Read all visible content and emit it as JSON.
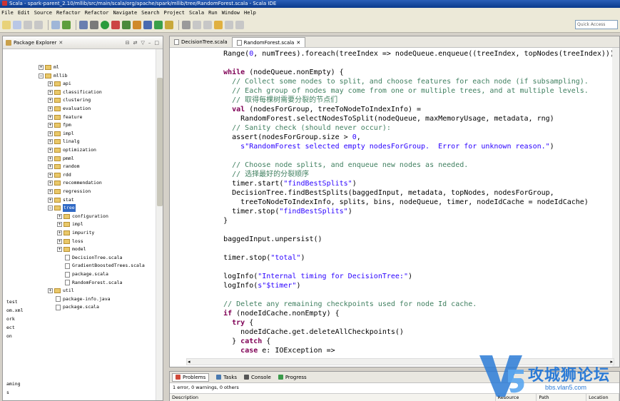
{
  "window": {
    "title": "Scala - spark-parent_2.10/mllib/src/main/scala/org/apache/spark/mllib/tree/RandomForest.scala - Scala IDE"
  },
  "menu": [
    "File",
    "Edit",
    "Source",
    "Refactor",
    "Refactor",
    "Navigate",
    "Search",
    "Project",
    "Scala",
    "Run",
    "Window",
    "Help"
  ],
  "toolbar": {
    "quick_access": "Quick Access"
  },
  "package_explorer": {
    "title": "Package Explorer",
    "tree": [
      {
        "label": "ml",
        "depth": 0,
        "kind": "folder",
        "expanded": false
      },
      {
        "label": "mllib",
        "depth": 0,
        "kind": "folder",
        "expanded": true
      },
      {
        "label": "api",
        "depth": 1,
        "kind": "folder",
        "expanded": false
      },
      {
        "label": "classification",
        "depth": 1,
        "kind": "folder",
        "expanded": false
      },
      {
        "label": "clustering",
        "depth": 1,
        "kind": "folder",
        "expanded": false
      },
      {
        "label": "evaluation",
        "depth": 1,
        "kind": "folder",
        "expanded": false
      },
      {
        "label": "feature",
        "depth": 1,
        "kind": "folder",
        "expanded": false
      },
      {
        "label": "fpm",
        "depth": 1,
        "kind": "folder",
        "expanded": false
      },
      {
        "label": "impl",
        "depth": 1,
        "kind": "folder",
        "expanded": false
      },
      {
        "label": "linalg",
        "depth": 1,
        "kind": "folder",
        "expanded": false
      },
      {
        "label": "optimization",
        "depth": 1,
        "kind": "folder",
        "expanded": false
      },
      {
        "label": "pmml",
        "depth": 1,
        "kind": "folder",
        "expanded": false
      },
      {
        "label": "random",
        "depth": 1,
        "kind": "folder",
        "expanded": false
      },
      {
        "label": "rdd",
        "depth": 1,
        "kind": "folder",
        "expanded": false
      },
      {
        "label": "recommendation",
        "depth": 1,
        "kind": "folder",
        "expanded": false
      },
      {
        "label": "regression",
        "depth": 1,
        "kind": "folder",
        "expanded": false
      },
      {
        "label": "stat",
        "depth": 1,
        "kind": "folder",
        "expanded": false
      },
      {
        "label": "tree",
        "depth": 1,
        "kind": "folder",
        "expanded": true,
        "selected": true
      },
      {
        "label": "configuration",
        "depth": 2,
        "kind": "folder",
        "expanded": false
      },
      {
        "label": "impl",
        "depth": 2,
        "kind": "folder",
        "expanded": false
      },
      {
        "label": "impurity",
        "depth": 2,
        "kind": "folder",
        "expanded": false
      },
      {
        "label": "loss",
        "depth": 2,
        "kind": "folder",
        "expanded": false
      },
      {
        "label": "model",
        "depth": 2,
        "kind": "folder",
        "expanded": false
      },
      {
        "label": "DecisionTree.scala",
        "depth": 2,
        "kind": "file"
      },
      {
        "label": "GradientBoostedTrees.scala",
        "depth": 2,
        "kind": "file"
      },
      {
        "label": "package.scala",
        "depth": 2,
        "kind": "file"
      },
      {
        "label": "RandomForest.scala",
        "depth": 2,
        "kind": "file"
      },
      {
        "label": "util",
        "depth": 1,
        "kind": "folder",
        "expanded": false
      },
      {
        "label": "package-info.java",
        "depth": 1,
        "kind": "file"
      },
      {
        "label": "package.scala",
        "depth": 1,
        "kind": "file"
      }
    ],
    "stray_items": [
      "test",
      "om.xml",
      "ork",
      "ect",
      "on"
    ],
    "stray_bottom": [
      "aming",
      "s"
    ]
  },
  "editor": {
    "tabs": [
      {
        "label": "DecisionTree.scala",
        "active": false
      },
      {
        "label": "RandomForest.scala",
        "active": true
      }
    ],
    "lines": [
      [
        [
          "",
          "    Range("
        ],
        [
          "st",
          "0"
        ],
        [
          "",
          ", numTrees).foreach(treeIndex => nodeQueue.enqueue((treeIndex, topNodes(treeIndex))))"
        ]
      ],
      [
        [
          "",
          ""
        ]
      ],
      [
        [
          "",
          "    "
        ],
        [
          "kw",
          "while"
        ],
        [
          "",
          " (nodeQueue.nonEmpty) {"
        ]
      ],
      [
        [
          "cm",
          "      // Collect some nodes to split, and choose features for each node (if subsampling)."
        ]
      ],
      [
        [
          "cm",
          "      // Each group of nodes may come from one or multiple trees, and at multiple levels."
        ]
      ],
      [
        [
          "cm",
          "      // 取得每棵树需要分裂的节点们"
        ]
      ],
      [
        [
          "",
          "      "
        ],
        [
          "kw",
          "val"
        ],
        [
          "",
          " (nodesForGroup, treeToNodeToIndexInfo) ="
        ]
      ],
      [
        [
          "",
          "        RandomForest.selectNodesToSplit(nodeQueue, maxMemoryUsage, metadata, rng)"
        ]
      ],
      [
        [
          "cm",
          "      // Sanity check (should never occur):"
        ]
      ],
      [
        [
          "",
          "      assert(nodesForGroup.size > "
        ],
        [
          "st",
          "0"
        ],
        [
          "",
          ","
        ]
      ],
      [
        [
          "",
          "        "
        ],
        [
          "st",
          "s\"RandomForest selected empty nodesForGroup.  Error for unknown reason.\""
        ],
        [
          "",
          ")"
        ]
      ],
      [
        [
          "",
          ""
        ]
      ],
      [
        [
          "cm",
          "      // Choose node splits, and enqueue new nodes as needed."
        ]
      ],
      [
        [
          "cm",
          "      // 选择最好的分裂顺序"
        ]
      ],
      [
        [
          "",
          "      timer.start("
        ],
        [
          "st",
          "\"findBestSplits\""
        ],
        [
          "",
          ")"
        ]
      ],
      [
        [
          "",
          "      DecisionTree.findBestSplits(baggedInput, metadata, topNodes, nodesForGroup,"
        ]
      ],
      [
        [
          "",
          "        treeToNodeToIndexInfo, splits, bins, nodeQueue, timer, nodeIdCache = nodeIdCache)"
        ]
      ],
      [
        [
          "",
          "      timer.stop("
        ],
        [
          "st",
          "\"findBestSplits\""
        ],
        [
          "",
          ")"
        ]
      ],
      [
        [
          "",
          "    }"
        ]
      ],
      [
        [
          "",
          ""
        ]
      ],
      [
        [
          "",
          "    baggedInput.unpersist()"
        ]
      ],
      [
        [
          "",
          ""
        ]
      ],
      [
        [
          "",
          "    timer.stop("
        ],
        [
          "st",
          "\"total\""
        ],
        [
          "",
          ")"
        ]
      ],
      [
        [
          "",
          ""
        ]
      ],
      [
        [
          "",
          "    logInfo("
        ],
        [
          "st",
          "\"Internal timing for DecisionTree:\""
        ],
        [
          "",
          ")"
        ]
      ],
      [
        [
          "",
          "    logInfo("
        ],
        [
          "st",
          "s\"$timer\""
        ],
        [
          "",
          ")"
        ]
      ],
      [
        [
          "",
          ""
        ]
      ],
      [
        [
          "cm",
          "    // Delete any remaining checkpoints used for node Id cache."
        ]
      ],
      [
        [
          "",
          "    "
        ],
        [
          "kw",
          "if"
        ],
        [
          "",
          " (nodeIdCache.nonEmpty) {"
        ]
      ],
      [
        [
          "",
          "      "
        ],
        [
          "kw",
          "try"
        ],
        [
          "",
          " {"
        ]
      ],
      [
        [
          "",
          "        nodeIdCache.get.deleteAllCheckpoints()"
        ]
      ],
      [
        [
          "",
          "      } "
        ],
        [
          "kw",
          "catch"
        ],
        [
          "",
          " {"
        ]
      ],
      [
        [
          "",
          "        "
        ],
        [
          "kw",
          "case"
        ],
        [
          "",
          " e: IOException =>"
        ]
      ]
    ]
  },
  "problems": {
    "tabs": [
      "Problems",
      "Tasks",
      "Console",
      "Progress"
    ],
    "summary": "1 error, 0 warnings, 0 others",
    "columns": [
      "Description",
      "Resource",
      "Path",
      "Location"
    ]
  },
  "watermark": {
    "name": "攻城狮论坛",
    "url": "bbs.vlan5.com"
  }
}
